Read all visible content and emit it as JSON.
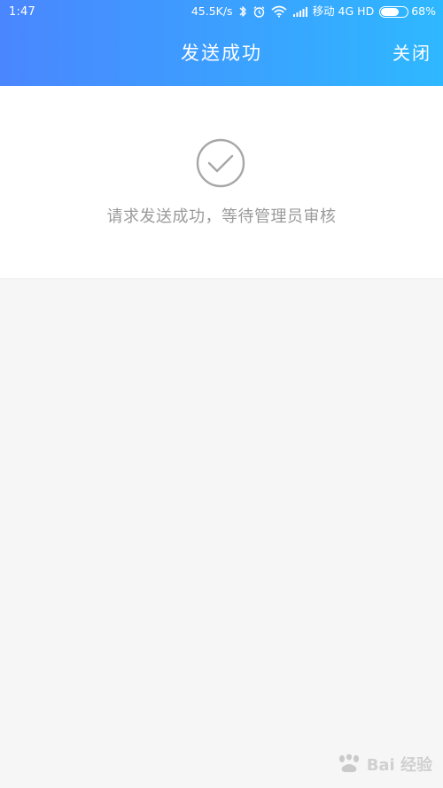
{
  "status_bar": {
    "time": "1:47",
    "network_speed": "45.5K/s",
    "carrier": "移动 4G HD",
    "battery_percent": "68%",
    "battery_level": 0.68,
    "icons": [
      "bluetooth-icon",
      "alarm-icon",
      "wifi-icon",
      "signal-icon",
      "battery-icon"
    ]
  },
  "header": {
    "title": "发送成功",
    "close_label": "关闭",
    "gradient_start": "#4a86ff",
    "gradient_end": "#2eb8ff"
  },
  "main": {
    "success_icon": "check-circle-icon",
    "message": "请求发送成功，等待管理员审核"
  },
  "watermark": {
    "text": "Bai 经验"
  },
  "colors": {
    "background": "#f6f6f6",
    "card": "#ffffff",
    "muted_text": "#9a9a9a"
  }
}
